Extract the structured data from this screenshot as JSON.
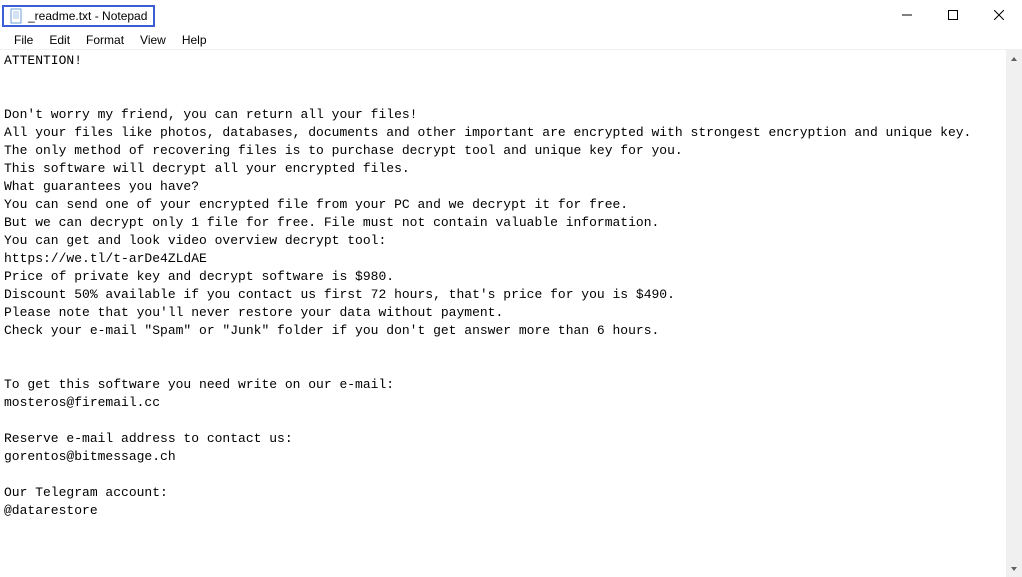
{
  "window": {
    "title": "_readme.txt - Notepad"
  },
  "menu": {
    "file": "File",
    "edit": "Edit",
    "format": "Format",
    "view": "View",
    "help": "Help"
  },
  "content": "ATTENTION!\n\n\nDon't worry my friend, you can return all your files!\nAll your files like photos, databases, documents and other important are encrypted with strongest encryption and unique key.\nThe only method of recovering files is to purchase decrypt tool and unique key for you.\nThis software will decrypt all your encrypted files.\nWhat guarantees you have?\nYou can send one of your encrypted file from your PC and we decrypt it for free.\nBut we can decrypt only 1 file for free. File must not contain valuable information.\nYou can get and look video overview decrypt tool:\nhttps://we.tl/t-arDe4ZLdAE\nPrice of private key and decrypt software is $980.\nDiscount 50% available if you contact us first 72 hours, that's price for you is $490.\nPlease note that you'll never restore your data without payment.\nCheck your e-mail \"Spam\" or \"Junk\" folder if you don't get answer more than 6 hours.\n\n\nTo get this software you need write on our e-mail:\nmosteros@firemail.cc\n\nReserve e-mail address to contact us:\ngorentos@bitmessage.ch\n\nOur Telegram account:\n@datarestore"
}
